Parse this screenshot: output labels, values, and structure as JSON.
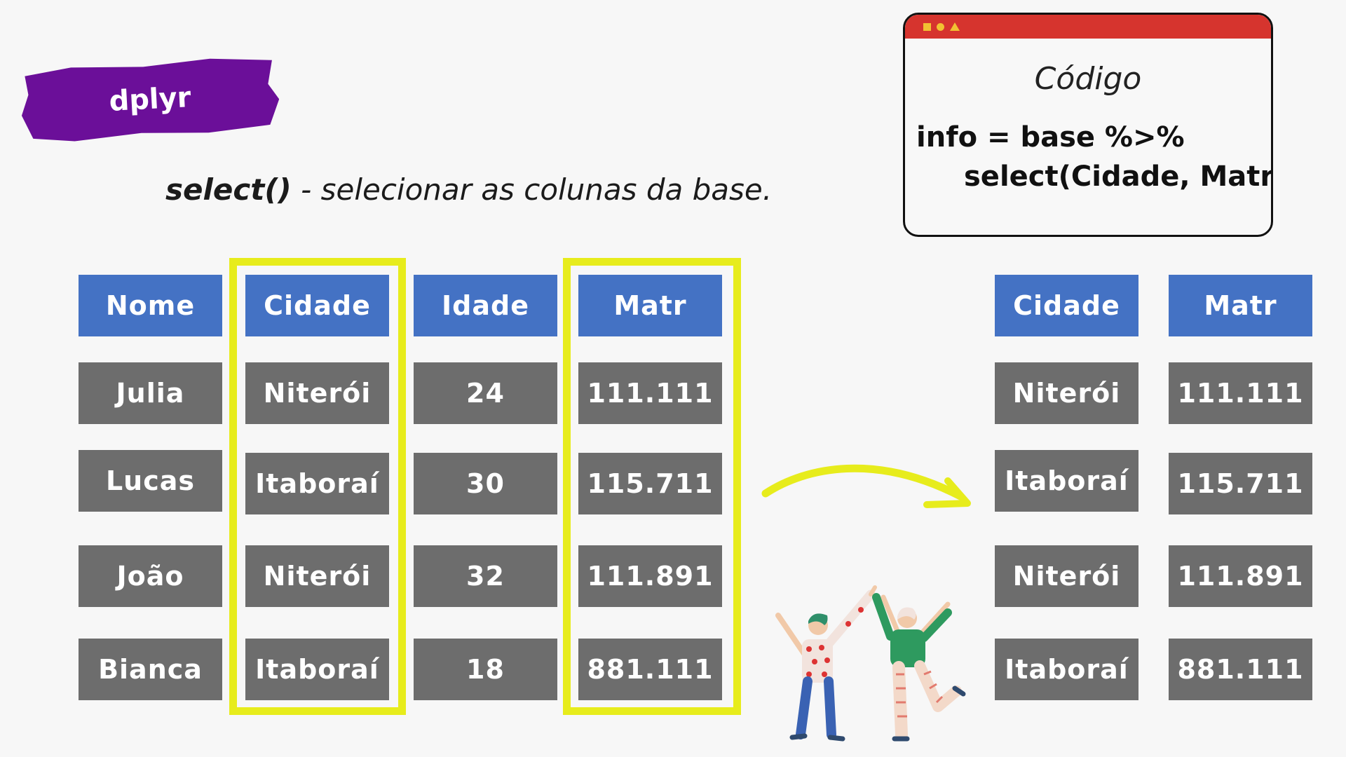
{
  "tag": {
    "label": "dplyr",
    "color": "#6b0f99"
  },
  "subtitle": {
    "func": "select()",
    "desc": " - selecionar as colunas da base."
  },
  "code": {
    "title": "Código",
    "line1": "info = base %>%",
    "line2": "select(Cidade, Matr)",
    "bar_color": "#d6342e"
  },
  "left_table": {
    "headers": [
      "Nome",
      "Cidade",
      "Idade",
      "Matr"
    ],
    "rows": [
      [
        "Julia",
        "Niterói",
        "24",
        "111.111"
      ],
      [
        "Lucas",
        "Itaboraí",
        "30",
        "115.711"
      ],
      [
        "João",
        "Niterói",
        "32",
        "111.891"
      ],
      [
        "Bianca",
        "Itaboraí",
        "18",
        "881.111"
      ]
    ]
  },
  "right_table": {
    "headers": [
      "Cidade",
      "Matr"
    ],
    "rows": [
      [
        "Niterói",
        "111.111"
      ],
      [
        "Itaboraí",
        "115.711"
      ],
      [
        "Niterói",
        "111.891"
      ],
      [
        "Itaboraí",
        "881.111"
      ]
    ]
  },
  "colors": {
    "header": "#4472c4",
    "cell": "#6d6d6d",
    "highlight": "#e7ec1c"
  }
}
